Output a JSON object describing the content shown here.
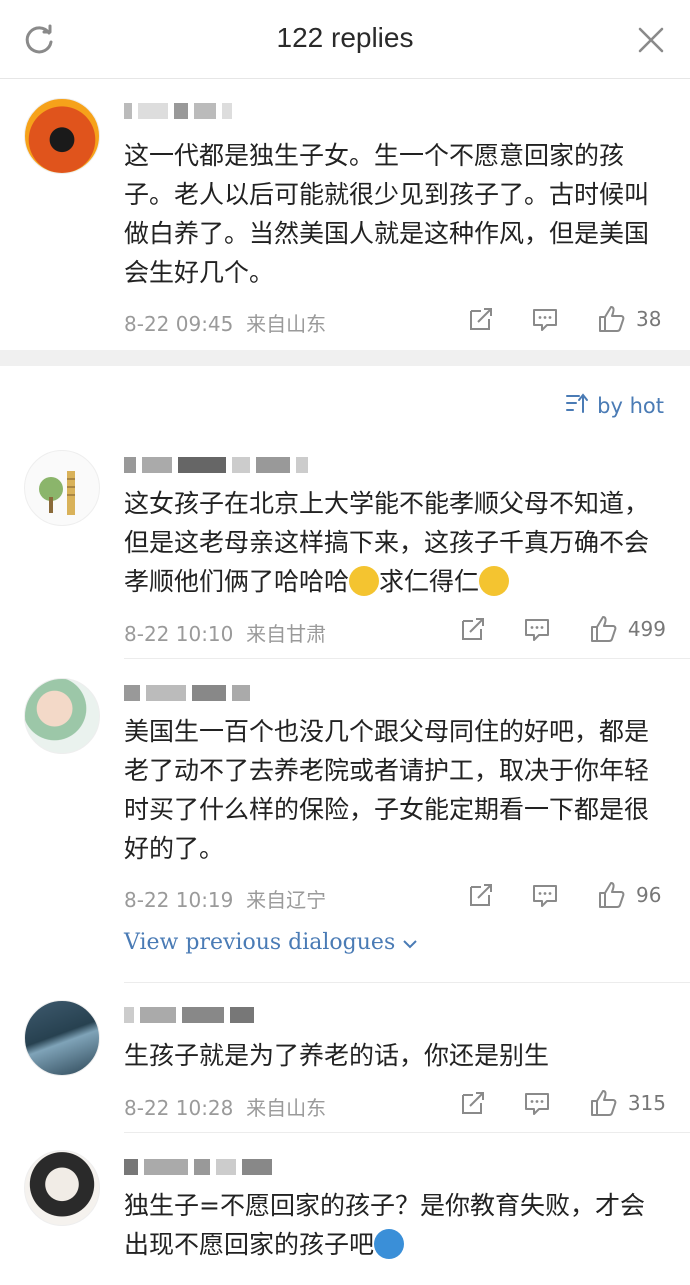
{
  "header": {
    "title": "122 replies"
  },
  "sort": {
    "label": "by hot"
  },
  "view_previous": "View previous dialogues",
  "comments": [
    {
      "text": "这一代都是独生子女。生一个不愿意回家的孩子。老人以后可能就很少见到孩子了。古时候叫做白养了。当然美国人就是这种作风，但是美国会生好几个。",
      "time": "8-22 09:45",
      "location": "来自山东",
      "likes": "38"
    },
    {
      "text_a": "这女孩子在北京上大学能不能孝顺父母不知道，但是这老母亲这样搞下来，这孩子千真万确不会孝顺他们俩了哈哈哈",
      "text_b": "求仁得仁",
      "time": "8-22 10:10",
      "location": "来自甘肃",
      "likes": "499"
    },
    {
      "text": "美国生一百个也没几个跟父母同住的好吧，都是老了动不了去养老院或者请护工，取决于你年轻时买了什么样的保险，子女能定期看一下都是很好的了。",
      "time": "8-22 10:19",
      "location": "来自辽宁",
      "likes": "96"
    },
    {
      "text": "生孩子就是为了养老的话，你还是别生",
      "time": "8-22 10:28",
      "location": "来自山东",
      "likes": "315"
    },
    {
      "text": "独生子=不愿回家的孩子？是你教育失败，才会出现不愿回家的孩子吧"
    }
  ],
  "colors": {
    "link": "#4a7bb5",
    "meta": "#9a9a9a",
    "divider": "#f0f0f0"
  }
}
